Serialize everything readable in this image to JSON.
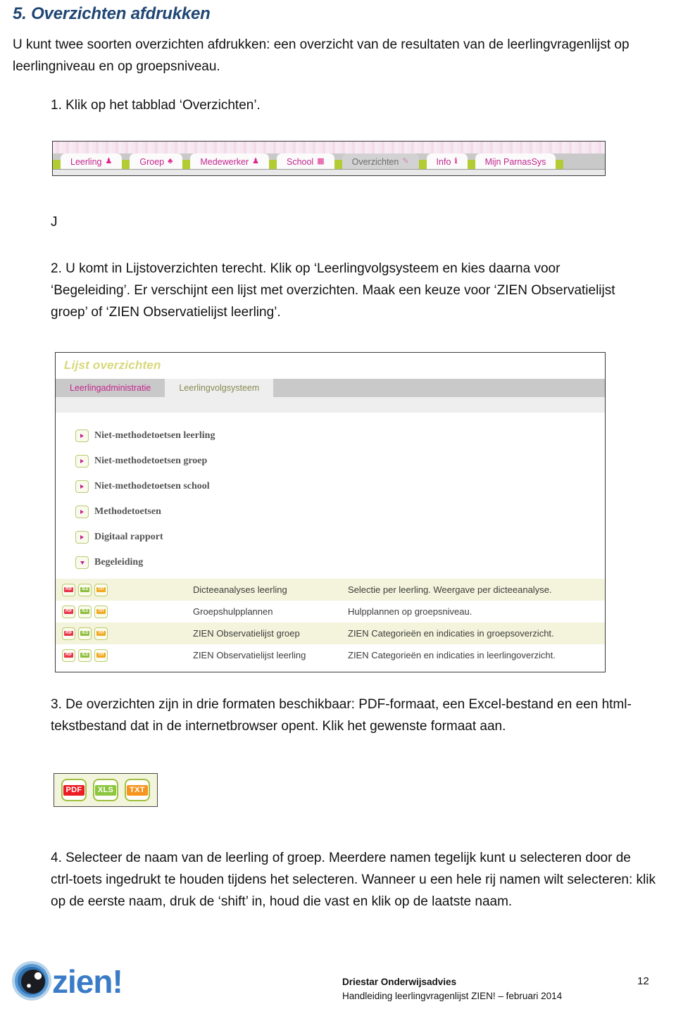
{
  "heading": "5. Overzichten afdrukken",
  "intro": "U kunt twee soorten overzichten afdrukken: een overzicht van de resultaten van de leerlingvragenlijst op leerlingniveau en op groepsniveau.",
  "step1": "1. Klik op het tabblad ‘Overzichten’.",
  "stray_char": "J",
  "step2": "2. U komt in Lijstoverzichten terecht. Klik op ‘Leerlingvolgsysteem en kies daarna voor ‘Begeleiding’. Er verschijnt een lijst met overzichten. Maak een keuze voor ‘ZIEN Observatielijst groep’ of ‘ZIEN Observatielijst leerling’.",
  "step3": "3. De overzichten zijn in drie formaten beschikbaar: PDF-formaat, een Excel-bestand en een html-tekstbestand dat in de internetbrowser opent. Klik het gewenste formaat aan.",
  "step4": "4. Selecteer de naam van de leerling of groep. Meerdere namen tegelijk kunt u selecteren door de ctrl-toets ingedrukt te houden tijdens het selecteren. Wanneer u een hele rij namen wilt selecteren: klik op de eerste naam, druk de ‘shift’ in, houd die vast en klik op de laatste naam.",
  "nav_screenshot": {
    "tabs": [
      {
        "label": "Leerling",
        "icon": "person-icon",
        "active": false
      },
      {
        "label": "Groep",
        "icon": "people-icon",
        "active": false
      },
      {
        "label": "Medewerker",
        "icon": "person-icon",
        "active": false
      },
      {
        "label": "School",
        "icon": "building-icon",
        "active": false
      },
      {
        "label": "Overzichten",
        "icon": "pencil-icon",
        "active": true
      },
      {
        "label": "Info",
        "icon": "info-icon",
        "active": false
      },
      {
        "label": "Mijn ParnasSys",
        "icon": "",
        "active": false
      }
    ],
    "accent_green": "#b4cc33",
    "accent_pink": "#c4278f"
  },
  "list_screenshot": {
    "title": "Lijst overzichten",
    "tabs": [
      {
        "label": "Leerlingadministratie",
        "active": false
      },
      {
        "label": "Leerlingvolgsysteem",
        "active": true
      }
    ],
    "tree": [
      {
        "label": "Niet-methodetoetsen leerling",
        "state": "collapsed"
      },
      {
        "label": "Niet-methodetoetsen groep",
        "state": "collapsed"
      },
      {
        "label": "Niet-methodetoetsen school",
        "state": "collapsed"
      },
      {
        "label": "Methodetoetsen",
        "state": "collapsed"
      },
      {
        "label": "Digitaal rapport",
        "state": "collapsed"
      },
      {
        "label": "Begeleiding",
        "state": "expanded"
      }
    ],
    "formats": [
      "PDF",
      "XLS",
      "TXT"
    ],
    "rows": [
      {
        "name": "Dicteeanalyses leerling",
        "description": "Selectie per leerling. Weergave per dicteeanalyse."
      },
      {
        "name": "Groepshulpplannen",
        "description": "Hulpplannen op groepsniveau."
      },
      {
        "name": "ZIEN Observatielijst groep",
        "description": "ZIEN Categorieën en indicaties in groepsoverzicht."
      },
      {
        "name": "ZIEN Observatielijst leerling",
        "description": "ZIEN Categorieën en indicaties in leerlingoverzicht."
      }
    ]
  },
  "format_screenshot": {
    "buttons": [
      {
        "label": "PDF",
        "color": "#ed1c24"
      },
      {
        "label": "XLS",
        "color": "#8dc63f"
      },
      {
        "label": "TXT",
        "color": "#f7941e"
      }
    ]
  },
  "footer": {
    "logo_word": "zien!",
    "logo_color": "#3a7bc8",
    "organisation": "Driestar Onderwijsadvies",
    "subtitle": "Handleiding leerlingvragenlijst ZIEN! – februari 2014",
    "page_number": "12"
  }
}
